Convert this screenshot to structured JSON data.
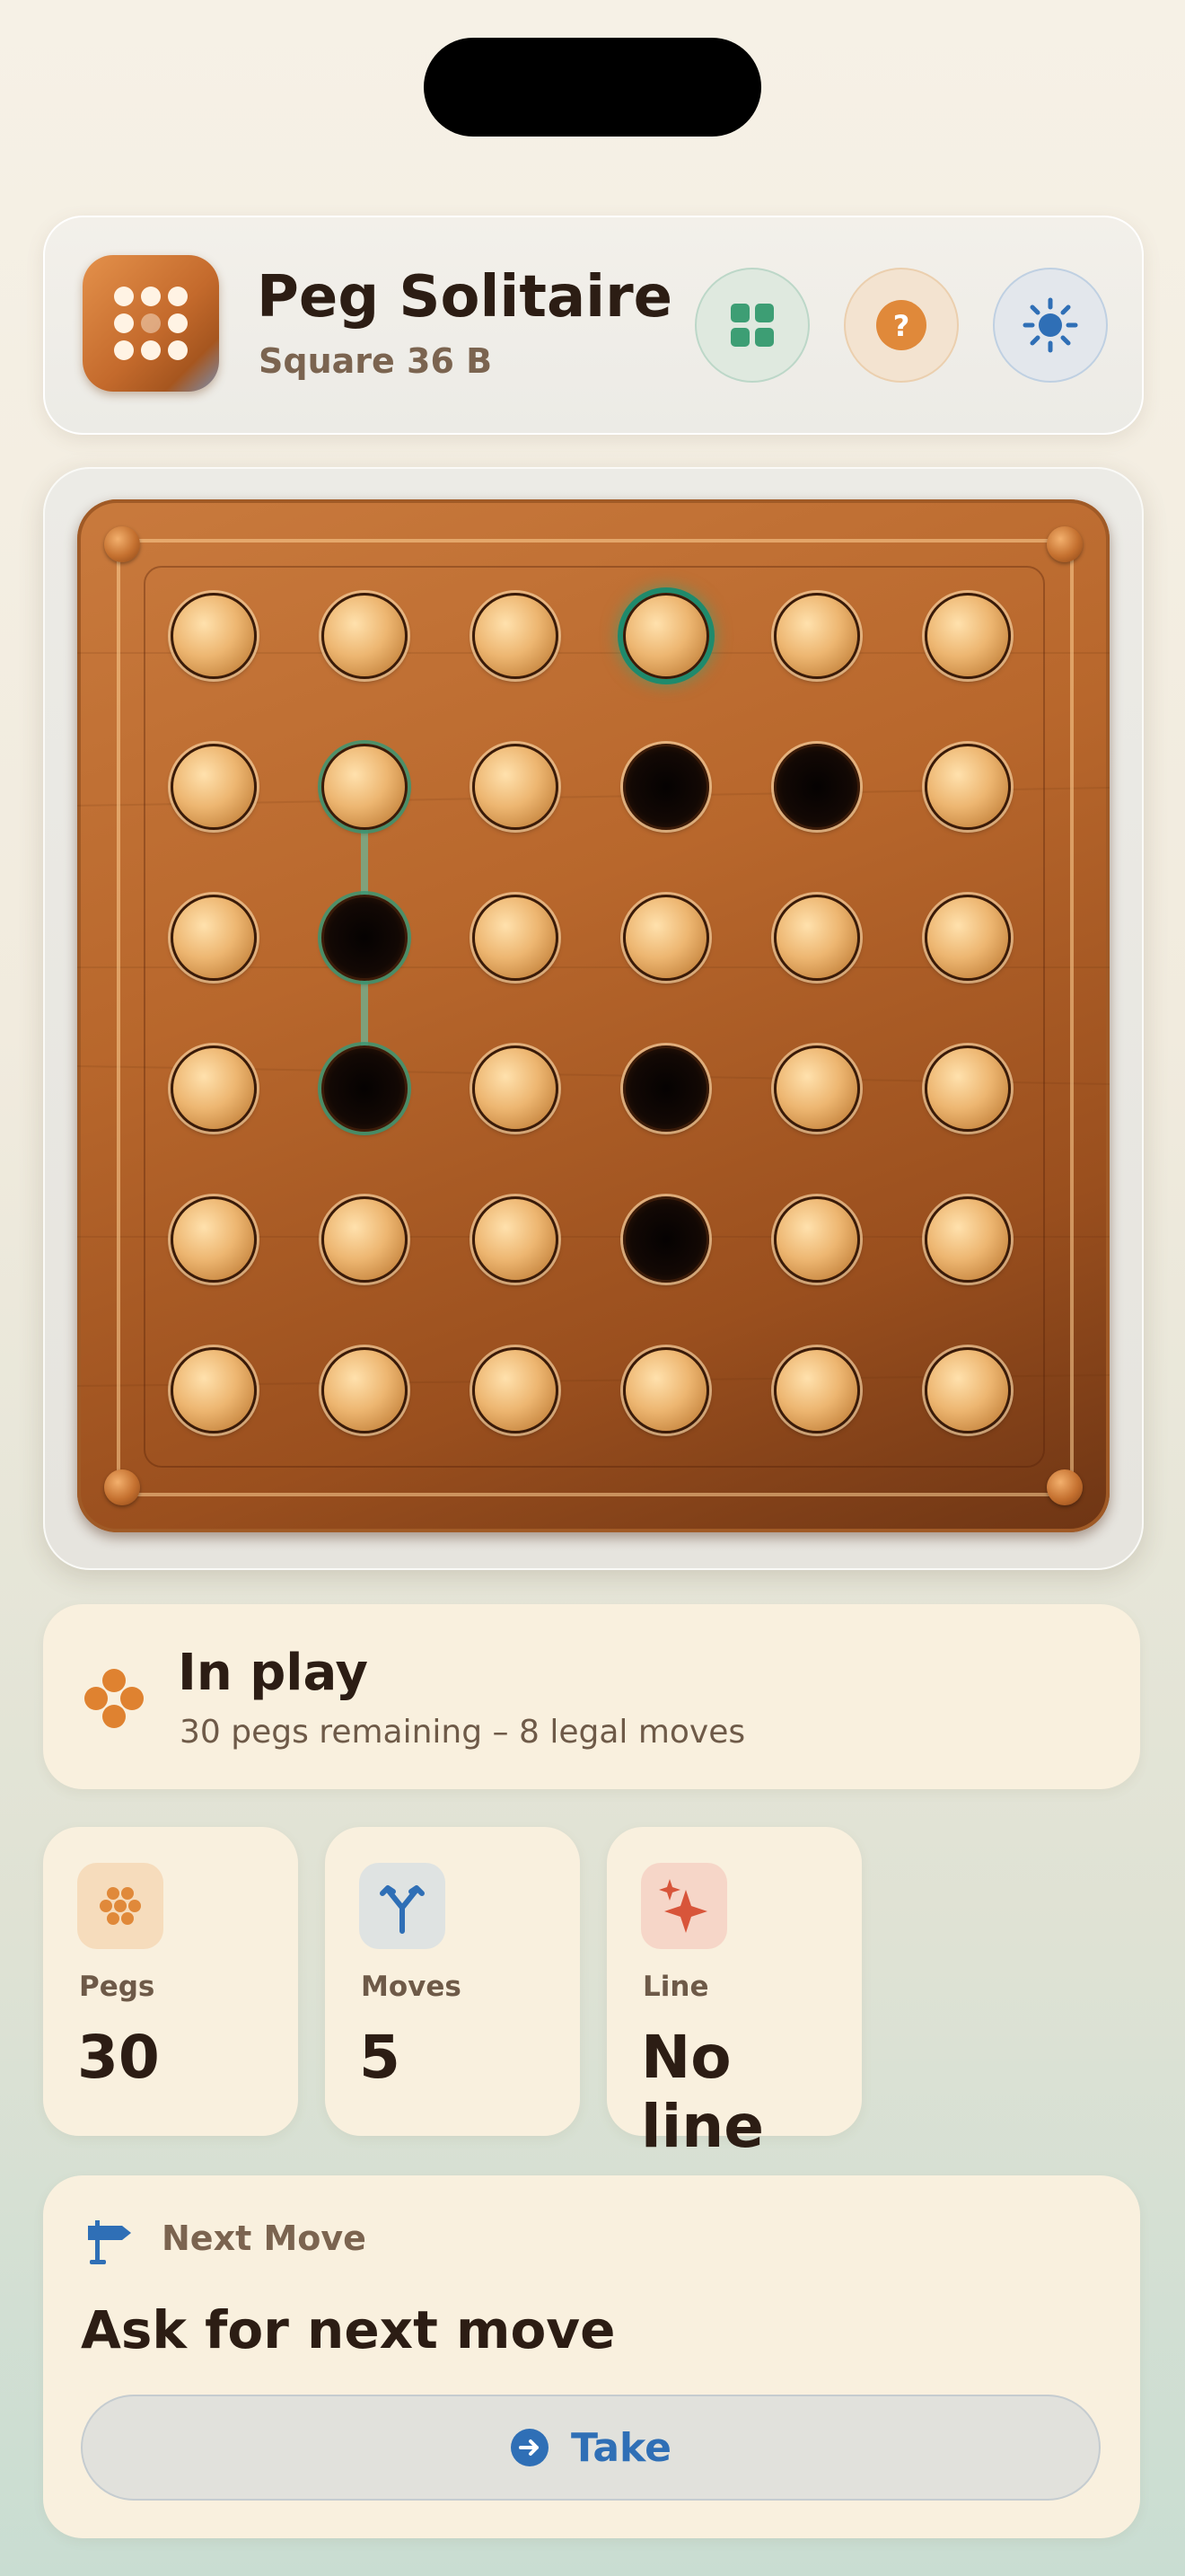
{
  "header": {
    "title": "Peg Solitaire",
    "subtitle": "Square 36 B",
    "buttons": [
      "grid-icon",
      "help-icon",
      "sun-icon"
    ]
  },
  "board": {
    "rows": 6,
    "cols": 6,
    "cells": [
      [
        "peg",
        "peg",
        "peg",
        "peg",
        "peg",
        "peg"
      ],
      [
        "peg",
        "peg",
        "peg",
        "hole",
        "hole",
        "peg"
      ],
      [
        "peg",
        "hole",
        "peg",
        "peg",
        "peg",
        "peg"
      ],
      [
        "peg",
        "hole",
        "peg",
        "hole",
        "peg",
        "peg"
      ],
      [
        "peg",
        "peg",
        "peg",
        "hole",
        "peg",
        "peg"
      ],
      [
        "peg",
        "peg",
        "peg",
        "peg",
        "peg",
        "peg"
      ]
    ],
    "selected": [
      0,
      3
    ],
    "hint_path": [
      [
        1,
        1
      ],
      [
        2,
        1
      ],
      [
        3,
        1
      ]
    ]
  },
  "status": {
    "title": "In play",
    "detail": "30 pegs remaining – 8 legal moves"
  },
  "stats": [
    {
      "label": "Pegs",
      "value": "30",
      "icon": "pegs-icon"
    },
    {
      "label": "Moves",
      "value": "5",
      "icon": "fork-icon"
    },
    {
      "label": "Line",
      "value": "No line",
      "icon": "sparkle-icon"
    }
  ],
  "next_move": {
    "label": "Next Move",
    "title": "Ask for next move",
    "button": "Take"
  },
  "colors": {
    "accent": "#2f6fb6",
    "orange": "#df8230",
    "wood": "#b8672c",
    "selection": "#1f8a6c"
  }
}
